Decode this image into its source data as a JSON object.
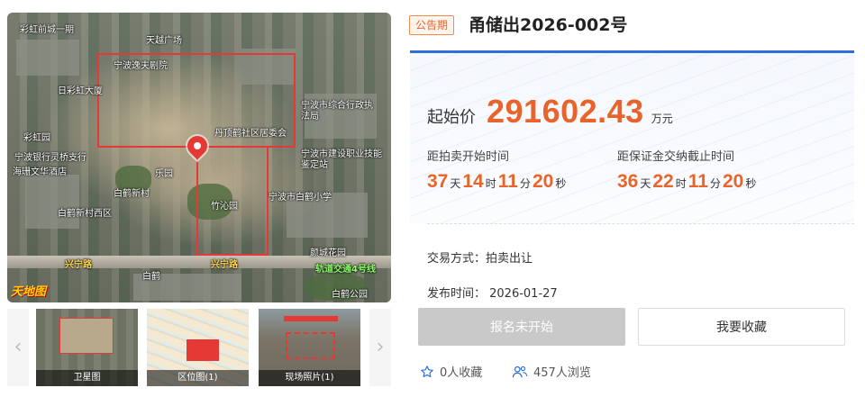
{
  "gallery": {
    "logo_text": "天地图",
    "map_labels": {
      "top_left": "彩虹前城一期",
      "square": "天越广场",
      "theater": "宁波逸夫剧院",
      "caihong": "日彩虹大厦",
      "admin_law": "宁波市综合行政执法局",
      "danding": "丹顶鹤社区居委会",
      "bank": "宁波银行灵桥支行",
      "hotel": "海珊文华酒店",
      "caihong_park": "彩虹园",
      "lequan": "乐园",
      "baihe_village": "白鹤新村",
      "baihe_village_west": "白鹤新村西区",
      "xinqin_garden": "竹沁园",
      "construction_bureau": "宁波市建设职业技能鉴定站",
      "baihe_school": "宁波市白鹤小学",
      "yanhe": "颜城花园",
      "xingning_road_left": "兴宁路",
      "xingning_road_right": "兴宁路",
      "baihe_station": "白鹤",
      "metro_line": "轨道交通4号线",
      "baihe_park": "白鹤公园"
    },
    "prev_arrow": "‹",
    "next_arrow": "›",
    "thumbnails": [
      {
        "caption": "卫星图"
      },
      {
        "caption": "区位图(1)"
      },
      {
        "caption": "现场照片(1)"
      }
    ]
  },
  "header": {
    "tag": "公告期",
    "title": "甬储出2026-002号"
  },
  "price": {
    "label": "起始价",
    "value": "291602.43",
    "unit": "万元"
  },
  "countdowns": [
    {
      "label": "距拍卖开始时间",
      "days": "37",
      "days_unit": "天",
      "hours": "14",
      "hours_unit": "时",
      "minutes": "11",
      "minutes_unit": "分",
      "seconds": "20",
      "seconds_unit": "秒"
    },
    {
      "label": "距保证金交纳截止时间",
      "days": "36",
      "days_unit": "天",
      "hours": "22",
      "hours_unit": "时",
      "minutes": "11",
      "minutes_unit": "分",
      "seconds": "20",
      "seconds_unit": "秒"
    }
  ],
  "info": {
    "trade_method": "交易方式：拍卖出让",
    "publish_time": "发布时间：  2026-01-27"
  },
  "actions": {
    "signup_label": "报名未开始",
    "favorite_label": "我要收藏"
  },
  "stats": {
    "favorites": "0人收藏",
    "views": "457人浏览"
  },
  "colors": {
    "accent_orange": "#e8642b",
    "accent_blue": "#2f6fd8",
    "disabled_gray": "#c9c9c9",
    "star_blue": "#2f6fd8"
  },
  "icons": {
    "favorite": "star-outline-icon",
    "views": "users-icon"
  }
}
